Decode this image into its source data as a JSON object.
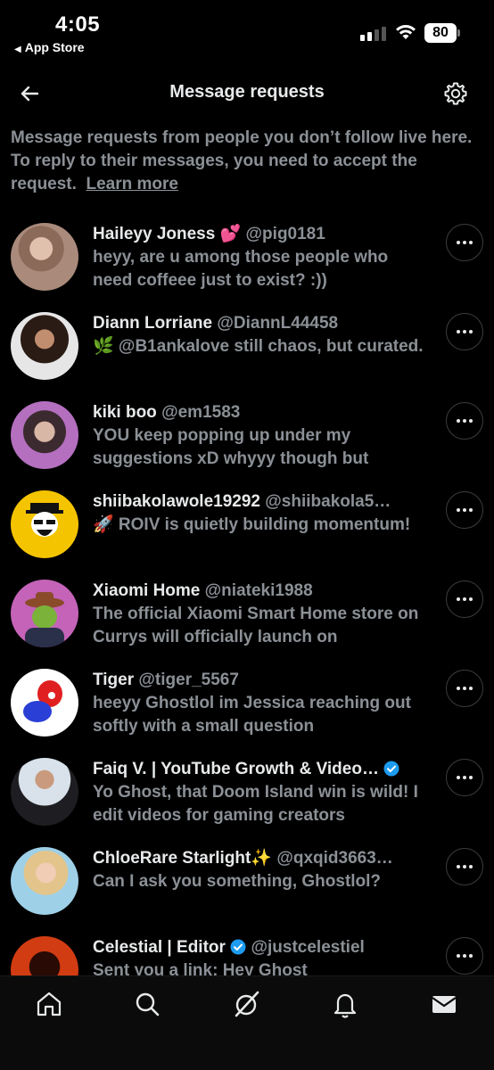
{
  "status_bar": {
    "time": "4:05",
    "back_app": "App Store",
    "battery": "80"
  },
  "header": {
    "title": "Message requests"
  },
  "intro": {
    "text": "Message requests from people you don’t follow live here. To reply to their messages, you need to accept the request.",
    "learn_more": "Learn more"
  },
  "requests": [
    {
      "name": "Haileyy Joness 💕",
      "handle": "@pig0181",
      "message": "heyy, are u among those people who need coffeee just to exist? :))",
      "verified": false
    },
    {
      "name": "Diann Lorriane",
      "handle": "@DiannL44458",
      "message": "🌿 @B1ankalove still chaos, but curated.",
      "verified": false
    },
    {
      "name": "kiki boo",
      "handle": "@em1583",
      "message": "YOU keep popping up under my suggestions xD whyyy though but",
      "verified": false
    },
    {
      "name": "shiibakolawole19292",
      "handle": "@shiibakola5…",
      "message": "🚀 ROIV is quietly building momentum!",
      "verified": false
    },
    {
      "name": "Xiaomi Home",
      "handle": "@niateki1988",
      "message": "The official Xiaomi Smart Home store on Currys will officially launch on",
      "verified": false
    },
    {
      "name": "Tiger",
      "handle": "@tiger_5567",
      "message": "heeyy Ghostlol im Jessica reaching out softly with a small question",
      "verified": false
    },
    {
      "name": "Faiq V. | YouTube Growth & Video…",
      "handle": "",
      "message": "Yo Ghost, that Doom Island win is wild! I edit videos for gaming creators",
      "verified": true
    },
    {
      "name": "ChloeRare Starlight✨",
      "handle": "@qxqid3663…",
      "message": "Can I ask you something, Ghostlol?",
      "verified": false
    },
    {
      "name": "Celestial | Editor",
      "handle": "@justcelestiel",
      "message": "Sent you a link: Hey Ghost",
      "verified": true
    }
  ],
  "colors": {
    "background": "#000000",
    "text": "#e7e9ea",
    "muted": "#8b9096",
    "verified": "#1d9bf0"
  },
  "icons": {
    "back": "arrow-left-icon",
    "settings": "gear-icon",
    "more": "more-icon",
    "nav": [
      "home-icon",
      "search-icon",
      "grok-icon",
      "bell-icon",
      "mail-icon"
    ]
  }
}
